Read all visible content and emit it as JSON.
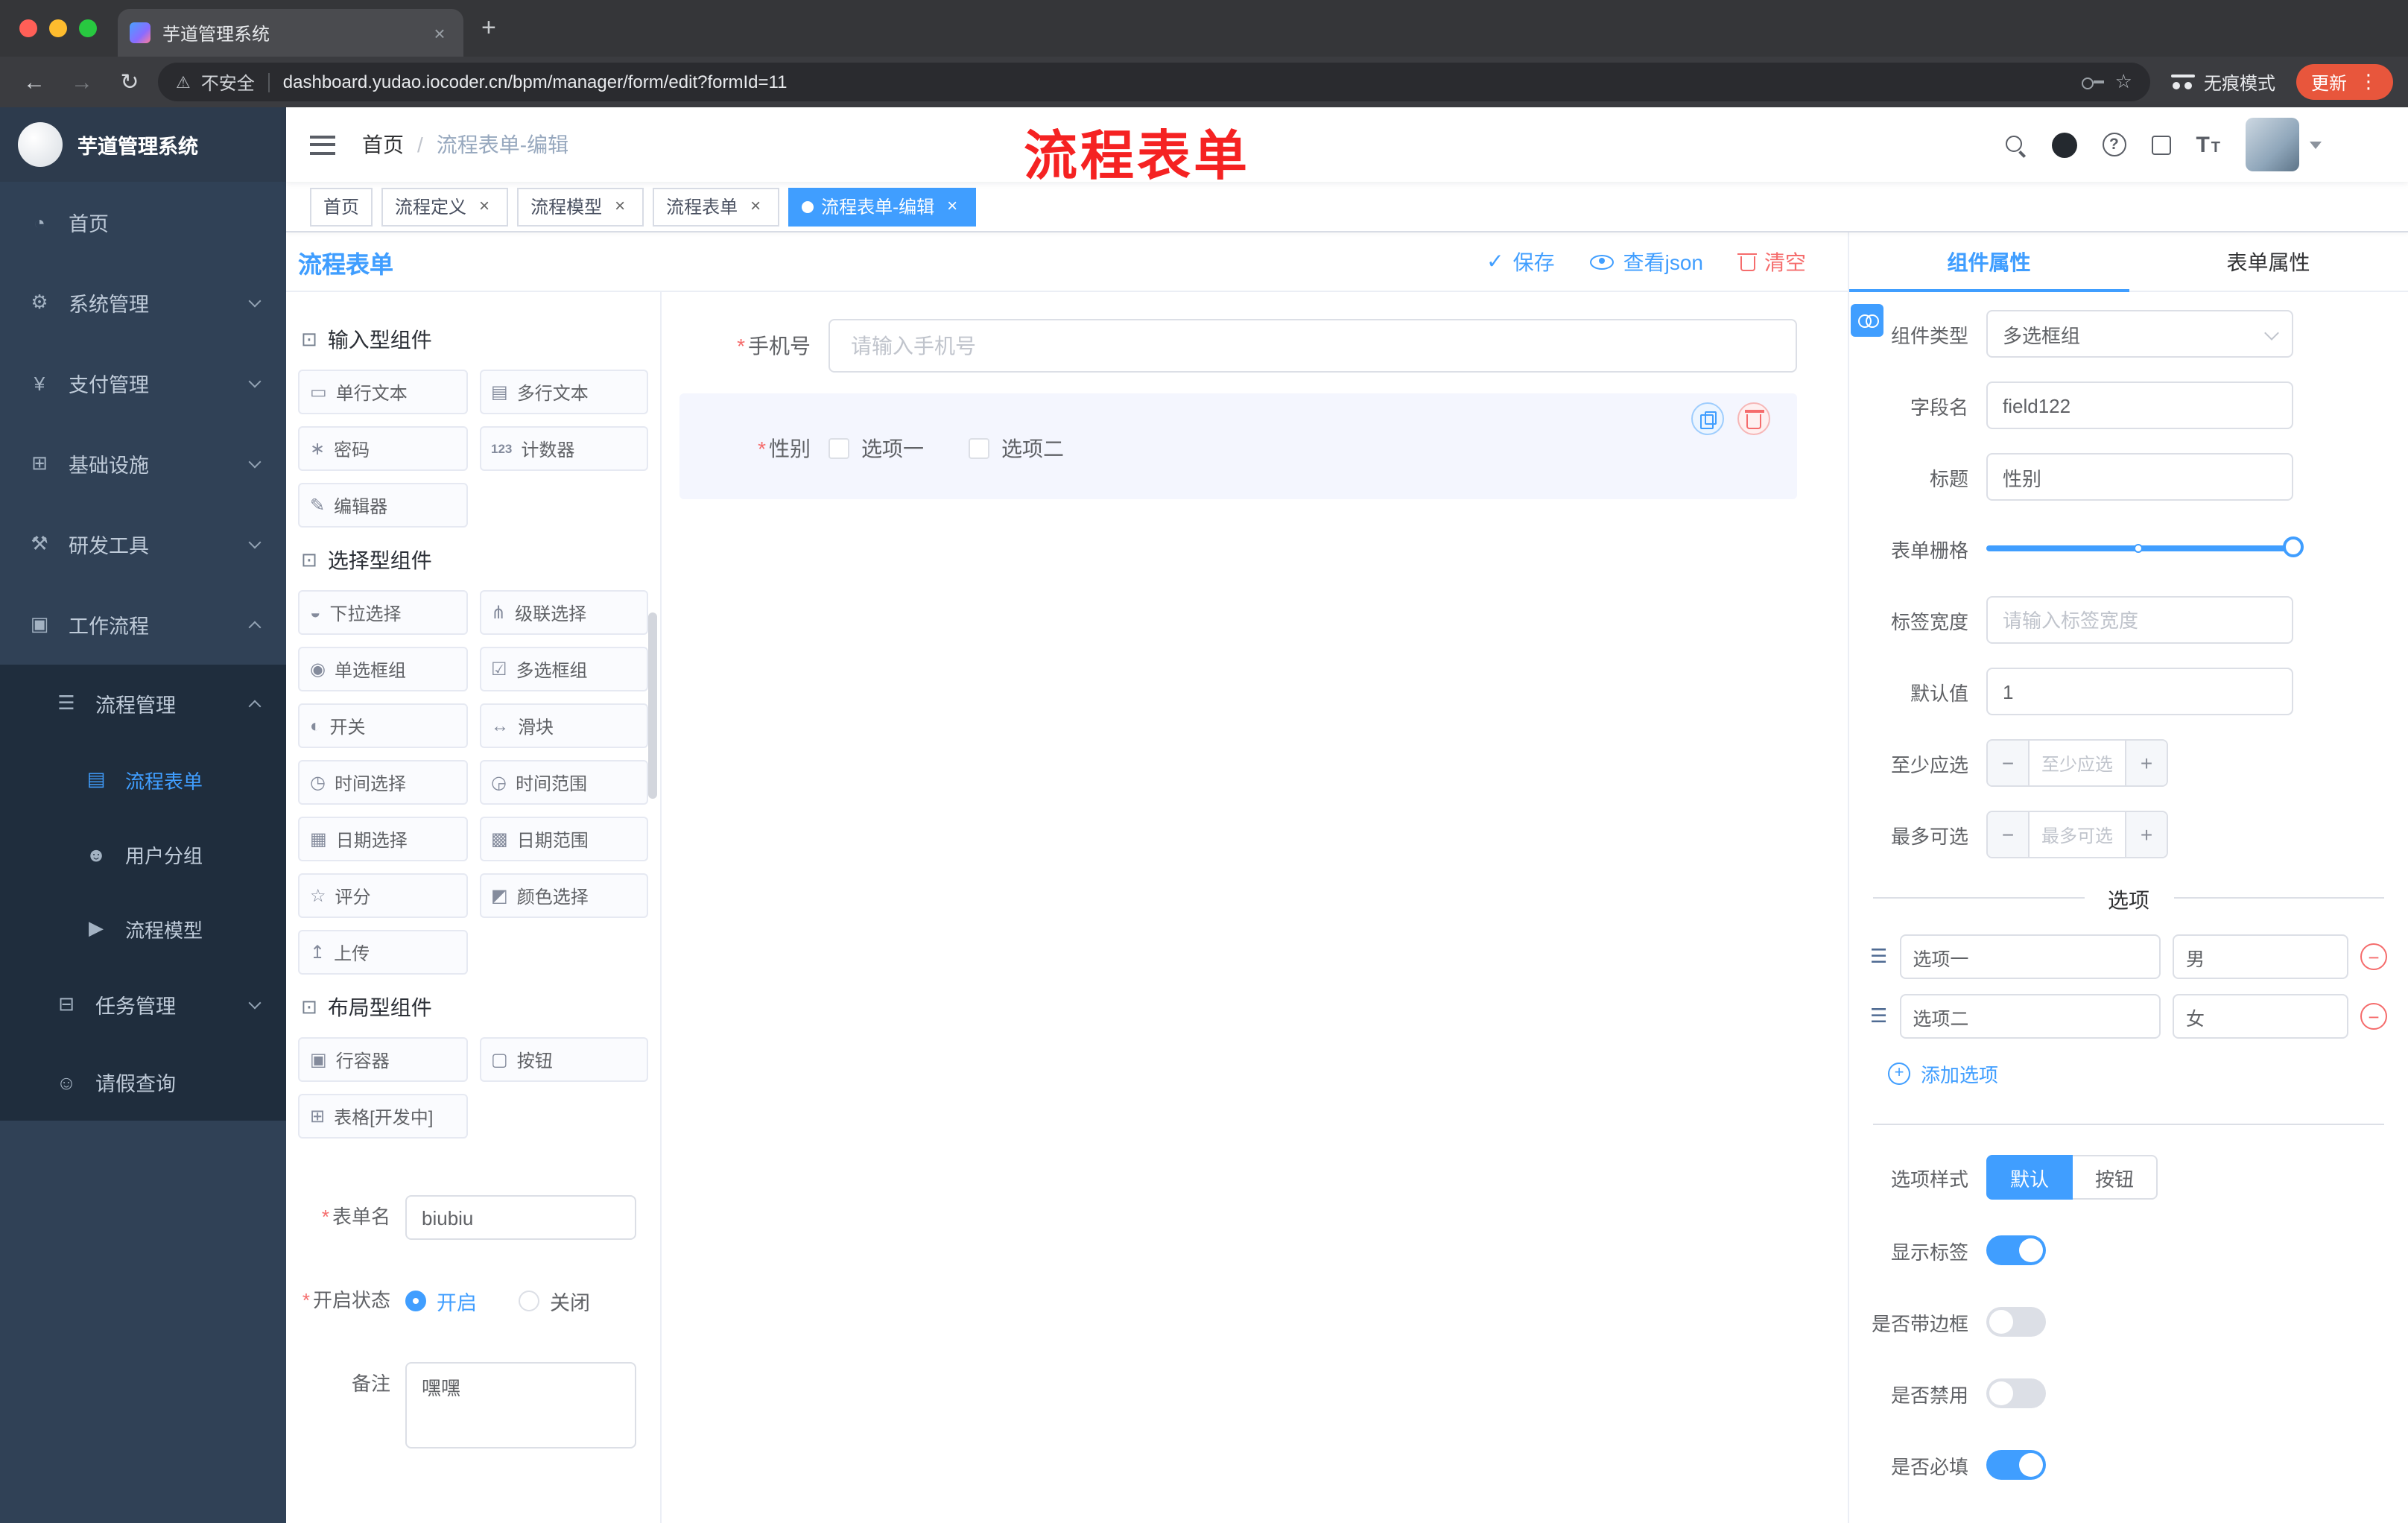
{
  "glyphs": {
    "close": "×",
    "plus": "+",
    "minus": "−",
    "kebab": "⋮",
    "back": "←",
    "forward": "→",
    "reload": "↻",
    "warning": "⚠",
    "star": "☆",
    "check": "✓",
    "asterisk": "*",
    "slash": "/",
    "question": "?",
    "cube": "⊡",
    "drag": "☰",
    "font_big": "T",
    "font_small": "T"
  },
  "colors": {
    "primary": "#409eff",
    "danger": "#f56c6c",
    "sidebar_bg": "#304156",
    "submenu_bg": "#1f2d3d",
    "annotation_red": "#f52222",
    "update_pill": "#e8563c",
    "selected_block_bg": "#f4f6fe",
    "tag_active_bg": "#409eff"
  },
  "browser": {
    "tab_title": "芋道管理系统",
    "security_label": "不安全",
    "url": "dashboard.yudao.iocoder.cn/bpm/manager/form/edit?formId=11",
    "incognito_label": "无痕模式",
    "update_label": "更新"
  },
  "annotation": "流程表单",
  "sidebar": {
    "logo_title": "芋道管理系统",
    "items": [
      {
        "label": "首页",
        "icon": "◔"
      },
      {
        "label": "系统管理",
        "icon": "⚙"
      },
      {
        "label": "支付管理",
        "icon": "¥"
      },
      {
        "label": "基础设施",
        "icon": "⊞"
      },
      {
        "label": "研发工具",
        "icon": "⚒"
      },
      {
        "label": "工作流程",
        "icon": "▣"
      },
      {
        "label": "流程管理",
        "icon": "☰"
      },
      {
        "label": "流程表单",
        "icon": "▤"
      },
      {
        "label": "用户分组",
        "icon": "☻"
      },
      {
        "label": "流程模型",
        "icon": "▶"
      },
      {
        "label": "任务管理",
        "icon": "⊟"
      },
      {
        "label": "请假查询",
        "icon": "☺"
      }
    ]
  },
  "header": {
    "breadcrumb_root": "首页",
    "breadcrumb_current": "流程表单-编辑"
  },
  "tabs": [
    {
      "label": "首页"
    },
    {
      "label": "流程定义"
    },
    {
      "label": "流程模型"
    },
    {
      "label": "流程表单"
    },
    {
      "label": "流程表单-编辑"
    }
  ],
  "designer": {
    "panel_title": "流程表单",
    "toolbar": {
      "save": "保存",
      "view_json": "查看json",
      "clear": "清空"
    },
    "palette": {
      "sections": [
        {
          "title": "输入型组件",
          "items": [
            {
              "label": "单行文本",
              "icon": "▭"
            },
            {
              "label": "多行文本",
              "icon": "▤"
            },
            {
              "label": "密码",
              "icon": "∗"
            },
            {
              "label": "计数器",
              "icon": "123"
            },
            {
              "label": "编辑器",
              "icon": "✎"
            }
          ]
        },
        {
          "title": "选择型组件",
          "items": [
            {
              "label": "下拉选择",
              "icon": "◒"
            },
            {
              "label": "级联选择",
              "icon": "⋔"
            },
            {
              "label": "单选框组",
              "icon": "◉"
            },
            {
              "label": "多选框组",
              "icon": "☑"
            },
            {
              "label": "开关",
              "icon": "◐"
            },
            {
              "label": "滑块",
              "icon": "↔"
            },
            {
              "label": "时间选择",
              "icon": "◷"
            },
            {
              "label": "时间范围",
              "icon": "◶"
            },
            {
              "label": "日期选择",
              "icon": "▦"
            },
            {
              "label": "日期范围",
              "icon": "▩"
            },
            {
              "label": "评分",
              "icon": "☆"
            },
            {
              "label": "颜色选择",
              "icon": "◩"
            },
            {
              "label": "上传",
              "icon": "↥"
            }
          ]
        },
        {
          "title": "布局型组件",
          "items": [
            {
              "label": "行容器",
              "icon": "▣"
            },
            {
              "label": "按钮",
              "icon": "▢"
            },
            {
              "label": "表格[开发中]",
              "icon": "⊞"
            }
          ]
        }
      ]
    },
    "meta_form": {
      "form_name_label": "表单名",
      "form_name_value": "biubiu",
      "status_label": "开启状态",
      "status_on": "开启",
      "status_off": "关闭",
      "remark_label": "备注",
      "remark_value": "嘿嘿"
    },
    "canvas": {
      "phone_label": "手机号",
      "phone_placeholder": "请输入手机号",
      "gender_label": "性别",
      "gender_options": [
        "选项一",
        "选项二"
      ]
    }
  },
  "props": {
    "tab_component": "组件属性",
    "tab_form": "表单属性",
    "rows": {
      "type_label": "组件类型",
      "type_value": "多选框组",
      "field_label": "字段名",
      "field_value": "field122",
      "title_label": "标题",
      "title_value": "性别",
      "grid_label": "表单栅格",
      "width_label": "标签宽度",
      "width_placeholder": "请输入标签宽度",
      "default_label": "默认值",
      "default_value": "1",
      "min_label": "至少应选",
      "min_placeholder": "至少应选",
      "max_label": "最多可选",
      "max_placeholder": "最多可选"
    },
    "options_title": "选项",
    "options": [
      {
        "name": "选项一",
        "value": "男"
      },
      {
        "name": "选项二",
        "value": "女"
      }
    ],
    "add_option": "添加选项",
    "style_label": "选项样式",
    "style_default": "默认",
    "style_button": "按钮",
    "switch_show_label": "显示标签",
    "switch_border": "是否带边框",
    "switch_disabled": "是否禁用",
    "switch_required": "是否必填"
  }
}
